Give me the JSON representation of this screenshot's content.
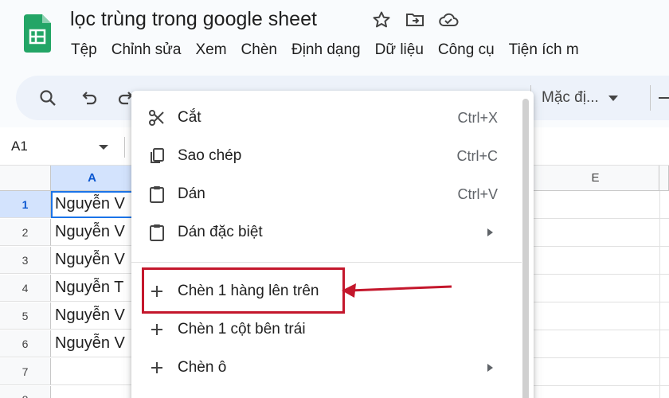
{
  "document": {
    "title": "lọc trùng trong google sheet"
  },
  "menubar": {
    "items": [
      "Tệp",
      "Chỉnh sửa",
      "Xem",
      "Chèn",
      "Định dạng",
      "Dữ liệu",
      "Công cụ",
      "Tiện ích m"
    ]
  },
  "toolbar": {
    "font_label": "Mặc đị..."
  },
  "namebox": {
    "value": "A1"
  },
  "grid": {
    "columns": [
      "A",
      "E"
    ],
    "rows": [
      {
        "num": "1",
        "a": "Nguyễn V"
      },
      {
        "num": "2",
        "a": "Nguyễn V"
      },
      {
        "num": "3",
        "a": "Nguyễn V"
      },
      {
        "num": "4",
        "a": " Nguyễn T"
      },
      {
        "num": "5",
        "a": "Nguyễn V"
      },
      {
        "num": "6",
        "a": "Nguyễn V"
      },
      {
        "num": "7",
        "a": ""
      },
      {
        "num": "8",
        "a": ""
      }
    ]
  },
  "context_menu": {
    "items": [
      {
        "label": "Cắt",
        "shortcut": "Ctrl+X",
        "icon": "scissors-icon"
      },
      {
        "label": "Sao chép",
        "shortcut": "Ctrl+C",
        "icon": "copy-icon"
      },
      {
        "label": "Dán",
        "shortcut": "Ctrl+V",
        "icon": "clipboard-icon"
      },
      {
        "label": "Dán đặc biệt",
        "shortcut": "",
        "icon": "clipboard-icon"
      },
      {
        "label": "Chèn 1 hàng lên trên",
        "shortcut": "",
        "icon": "plus-icon"
      },
      {
        "label": "Chèn 1 cột bên trái",
        "shortcut": "",
        "icon": "plus-icon"
      },
      {
        "label": "Chèn ô",
        "shortcut": "",
        "icon": "plus-icon"
      }
    ]
  },
  "colors": {
    "sheets_green": "#23a566",
    "highlight_red": "#c4172c",
    "selection_blue": "#1a73e8"
  }
}
